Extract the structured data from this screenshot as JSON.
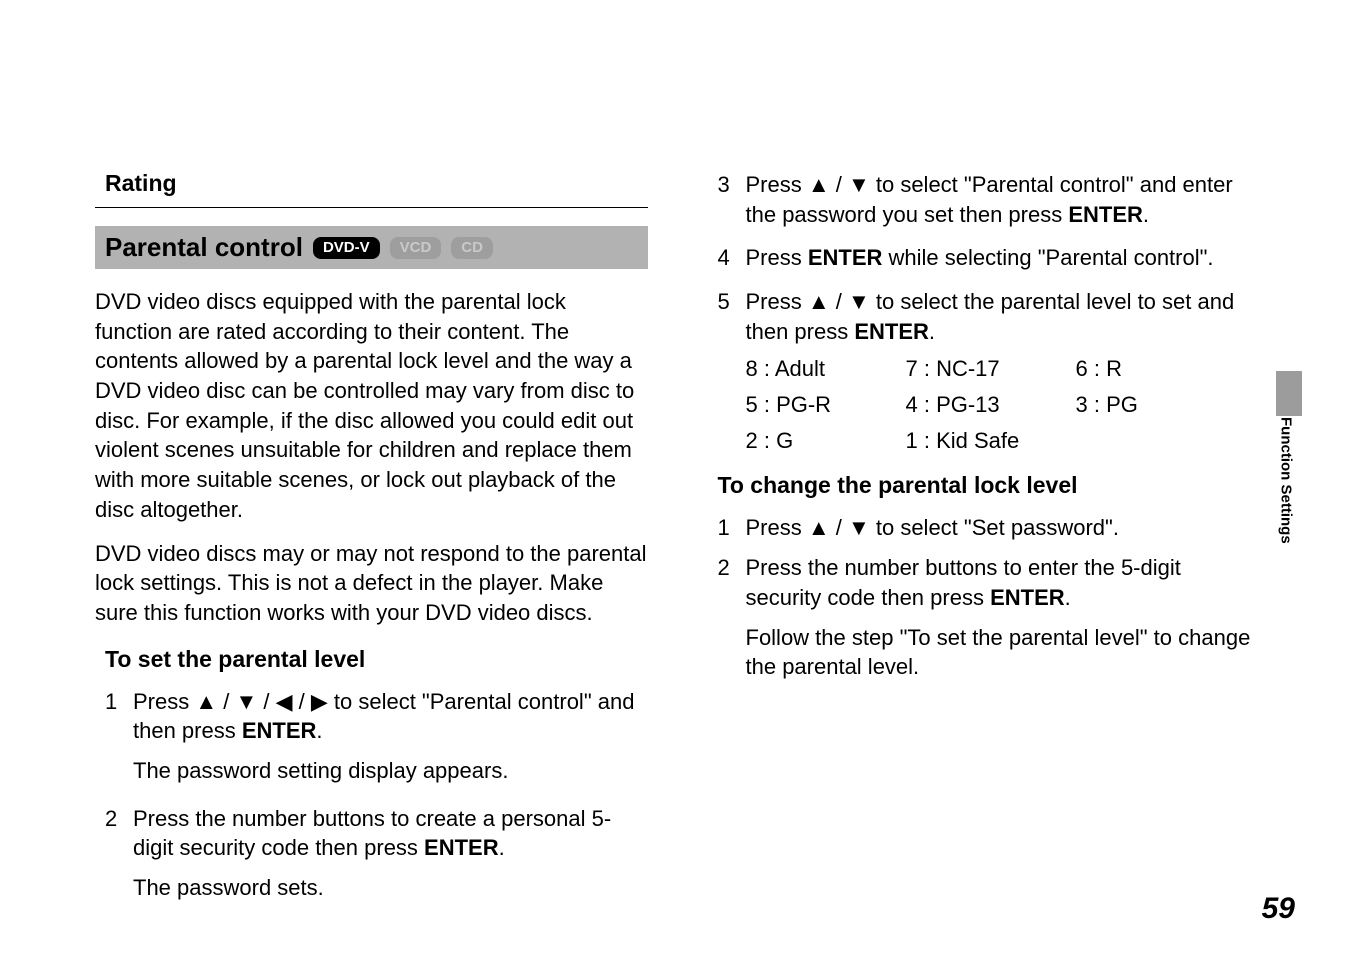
{
  "left": {
    "rating_head": "Rating",
    "titlebar": {
      "title": "Parental control",
      "badges": {
        "dvdv": "DVD-V",
        "vcd": "VCD",
        "cd": "CD"
      }
    },
    "para1": "DVD video discs equipped with the parental lock function are rated according to their content. The contents allowed by a parental lock level and the way a DVD video disc can be controlled may vary from disc to disc. For example, if the disc allowed you could edit out violent scenes unsuitable for children and replace them with more suitable scenes, or lock out playback of the disc altogether.",
    "para2": "DVD video discs may or may not respond to the parental lock settings. This is not a defect in the player. Make sure this function works with your DVD video discs.",
    "subhead": "To set the parental level",
    "step1_pre": "Press ",
    "arrows4": "▲ / ▼ / ◀ / ▶",
    "step1_mid": " to select \"Parental control\" and then press ",
    "enter": "ENTER",
    "period": ".",
    "step1_sub": "The password setting display appears.",
    "step2_a": "Press the number buttons to create a personal 5-digit security code then press ",
    "step2_sub": "The password sets."
  },
  "right": {
    "step3_a": "Press ",
    "arrows2": "▲ / ▼",
    "step3_b": " to select \"Parental control\" and enter the password you set then press ",
    "step4_a": "Press ",
    "step4_b": " while selecting \"Parental control\".",
    "step5_a": "Press  ",
    "step5_b": " to select the parental level to set and then press ",
    "ratings": {
      "r0": "8 : Adult",
      "r1": "7 : NC-17",
      "r2": "6 : R",
      "r3": "5 : PG-R",
      "r4": "4 : PG-13",
      "r5": "3 : PG",
      "r6": "2 : G",
      "r7": "1 : Kid Safe",
      "r8": ""
    },
    "subhead2": "To change the parental lock level",
    "c1_a": "Press ",
    "c1_b": " to select \"Set password\".",
    "c2_a": "Press the number buttons to enter the 5-digit security code then press ",
    "c2_sub": "Follow the step \"To set the parental level\" to change the parental level."
  },
  "nums": {
    "n1": "1",
    "n2": "2",
    "n3": "3",
    "n4": "4",
    "n5": "5"
  },
  "sidetab": "Function Settings",
  "pagenum": "59"
}
